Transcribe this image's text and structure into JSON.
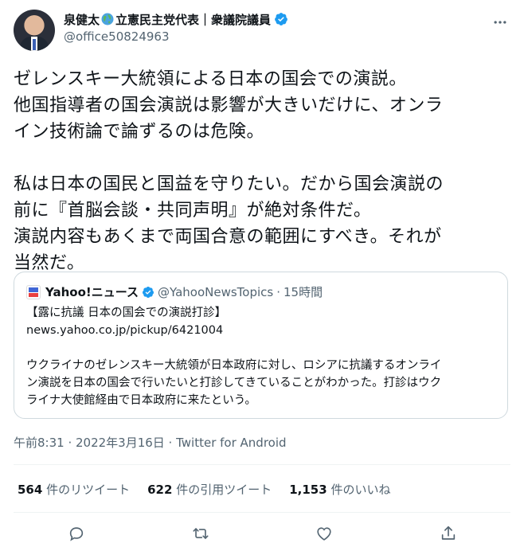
{
  "author": {
    "display_name_part1": "泉健太",
    "display_name_part2": "立憲民主党代表｜衆議院議員",
    "handle": "@office50824963"
  },
  "tweet": {
    "text": "ゼレンスキー大統領による日本の国会での演説。\n他国指導者の国会演説は影響が大きいだけに、オンラ\nイン技術論で論ずるのは危険。\n\n私は日本の国民と国益を守りたい。だから国会演説の\n前に『首脳会談・共同声明』が絶対条件だ。\n演説内容もあくまで両国合意の範囲にすべき。それが\n当然だ。"
  },
  "quote": {
    "name": "Yahoo!ニュース",
    "handle": "@YahooNewsTopics",
    "dot": "·",
    "time": "15時間",
    "text": "【露に抗議 日本の国会での演説打診】\nnews.yahoo.co.jp/pickup/6421004\n\nウクライナのゼレンスキー大統領が日本政府に対し、ロシアに抗議するオンライ\nン演説を日本の国会で行いたいと打診してきていることがわかった。打診はウク\nライナ大使館経由で日本政府に来たという。"
  },
  "meta": {
    "timestamp": "午前8:31 · 2022年3月16日 · Twitter for Android"
  },
  "stats": {
    "retweets_count": "564",
    "retweets_label": "件のリツイート",
    "quotes_count": "622",
    "quotes_label": "件の引用ツイート",
    "likes_count": "1,153",
    "likes_label": "件のいいね"
  },
  "colors": {
    "verified": "#1d9bf0",
    "secondary_text": "#536471",
    "icon": "#536471"
  }
}
